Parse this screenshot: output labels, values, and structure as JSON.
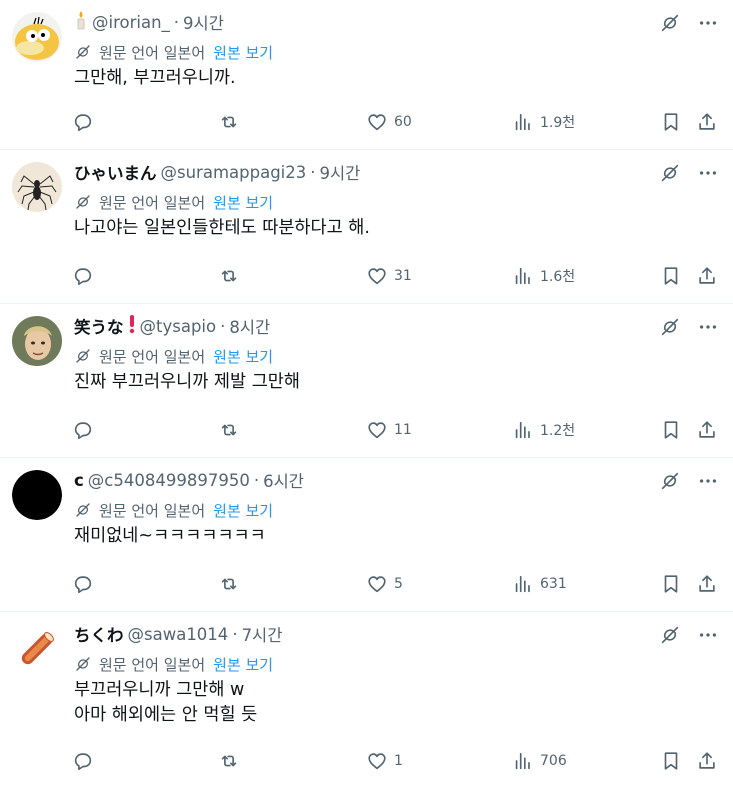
{
  "translate": {
    "label": "원문 언어 일본어",
    "link": "원본 보기"
  },
  "tweets": [
    {
      "name": "",
      "handle": "@irorian_",
      "time": "9시간",
      "body": [
        "그만해, 부끄러우니까."
      ],
      "replies": "",
      "retweets": "",
      "likes": "60",
      "views": "1.9천",
      "avatar": "duck-avatar",
      "name_icon": "candle-icon"
    },
    {
      "name": "ひゃいまん",
      "handle": "@suramappagi23",
      "time": "9시간",
      "body": [
        "나고야는 일본인들한테도 따분하다고 해."
      ],
      "replies": "",
      "retweets": "",
      "likes": "31",
      "views": "1.6천",
      "avatar": "spider-avatar"
    },
    {
      "name": "笑うな",
      "handle": "@tysapio",
      "time": "8시간",
      "body": [
        "진짜 부끄러우니까 제발 그만해"
      ],
      "replies": "",
      "retweets": "",
      "likes": "11",
      "views": "1.2천",
      "avatar": "face-avatar",
      "name_icon": "exclamation-icon"
    },
    {
      "name": "c",
      "handle": "@c5408499897950",
      "time": "6시간",
      "body": [
        "재미없네~ㅋㅋㅋㅋㅋㅋㅋ"
      ],
      "replies": "",
      "retweets": "",
      "likes": "5",
      "views": "631",
      "avatar": "black-circle-avatar"
    },
    {
      "name": "ちくわ",
      "handle": "@sawa1014",
      "time": "7시간",
      "body": [
        "부끄러우니까 그만해 w",
        "아마 해외에는 안 먹힐 듯"
      ],
      "replies": "",
      "retweets": "",
      "likes": "1",
      "views": "706",
      "avatar": "chikuwa-avatar"
    }
  ],
  "colors": {
    "text": "#0f1419",
    "secondary": "#536471",
    "link": "#1d9bf0",
    "divider": "#eff3f4",
    "exclamation": "#e0245e"
  }
}
